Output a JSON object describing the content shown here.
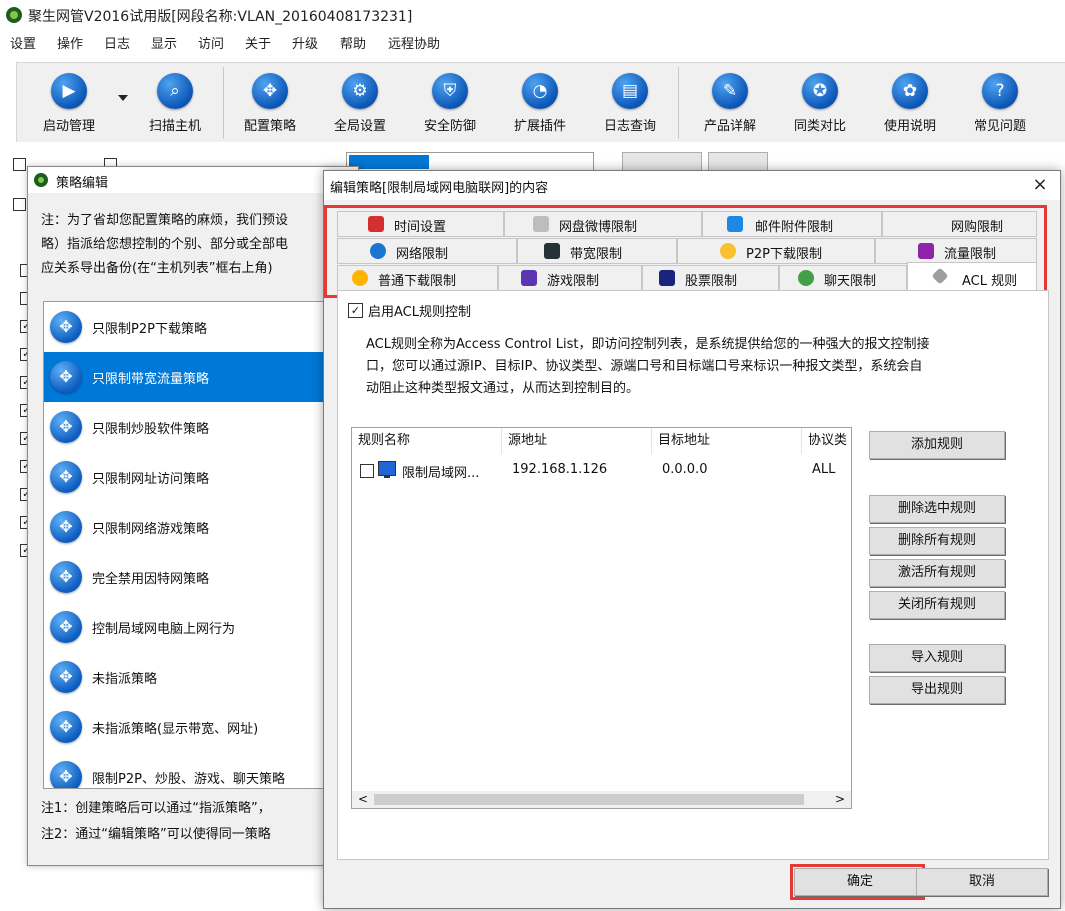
{
  "window": {
    "title": "聚生网管V2016试用版[网段名称:VLAN_20160408173231]"
  },
  "menu": [
    "设置",
    "操作",
    "日志",
    "显示",
    "访问",
    "关于",
    "升级",
    "帮助",
    "远程协助"
  ],
  "toolbar": [
    {
      "label": "启动管理",
      "icon": "play-icon"
    },
    {
      "label": "扫描主机",
      "icon": "search-icon"
    },
    {
      "label": "配置策略",
      "icon": "move-icon"
    },
    {
      "label": "全局设置",
      "icon": "gear-icon"
    },
    {
      "label": "安全防御",
      "icon": "shield-icon"
    },
    {
      "label": "扩展插件",
      "icon": "pie-icon"
    },
    {
      "label": "日志查询",
      "icon": "log-icon"
    },
    {
      "label": "产品详解",
      "icon": "edit-icon"
    },
    {
      "label": "同类对比",
      "icon": "graduation-icon"
    },
    {
      "label": "使用说明",
      "icon": "award-icon"
    },
    {
      "label": "常见问题",
      "icon": "question-icon"
    }
  ],
  "policy_window": {
    "title": "策略编辑",
    "notes": [
      "注：为了省却您配置策略的麻烦，我们预设",
      "略）指派给您想控制的个别、部分或全部电",
      "应关系导出备份(在“主机列表”框右上角)"
    ],
    "items": [
      "只限制P2P下载策略",
      "只限制带宽流量策略",
      "只限制炒股软件策略",
      "只限制网址访问策略",
      "只限制网络游戏策略",
      "完全禁用因特网策略",
      "控制局域网电脑上网行为",
      "未指派策略",
      "未指派策略(显示带宽、网址)",
      "限制P2P、炒股、游戏、聊天策略"
    ],
    "selected_index": 1,
    "footer_notes": [
      "注1：创建策略后可以通过“指派策略”，",
      "注2：通过“编辑策略”可以使得同一策略"
    ]
  },
  "dialog": {
    "title": "编辑策略[限制局域网电脑联网]的内容",
    "close": "×",
    "tabs_row1": [
      "时间设置",
      "网盘微博限制",
      "邮件附件限制",
      "网购限制"
    ],
    "tabs_row2": [
      "网络限制",
      "带宽限制",
      "P2P下载限制",
      "流量限制"
    ],
    "tabs_row3": [
      "普通下载限制",
      "游戏限制",
      "股票限制",
      "聊天限制",
      "ACL 规则"
    ],
    "active_tab": "ACL 规则",
    "enable_acl_label": "启用ACL规则控制",
    "enable_acl_checked": true,
    "description": [
      "ACL规则全称为Access Control List，即访问控制列表，是系统提供给您的一种强大的报文控制接",
      "口，您可以通过源IP、目标IP、协议类型、源端口号和目标端口号来标识一种报文类型，系统会自",
      "动阻止这种类型报文通过，从而达到控制目的。"
    ],
    "columns": [
      "规则名称",
      "源地址",
      "目标地址",
      "协议类"
    ],
    "rows": [
      {
        "name": "限制局域网...",
        "src": "192.168.1.126",
        "dst": "0.0.0.0",
        "proto": "ALL"
      }
    ],
    "buttons": {
      "add": "添加规则",
      "delete_selected": "删除选中规则",
      "delete_all": "删除所有规则",
      "activate_all": "激活所有规则",
      "close_all": "关闭所有规则",
      "import": "导入规则",
      "export": "导出规则"
    },
    "ok": "确定",
    "cancel": "取消"
  },
  "colors": {
    "highlight": "#e53935",
    "selection": "#0078d7",
    "icon_blue": "#0b56b8"
  }
}
